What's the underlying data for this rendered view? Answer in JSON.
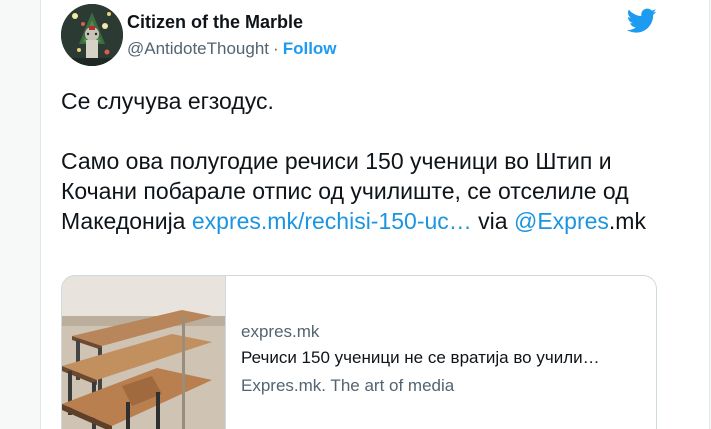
{
  "user": {
    "display_name": "Citizen of the Marble",
    "handle": "@AntidoteThought",
    "separator": "·",
    "follow_label": "Follow",
    "avatar_icon": "avatar-photo"
  },
  "brand": {
    "icon": "twitter-bird-icon",
    "color": "#1d9bf0"
  },
  "tweet": {
    "line1": "Се случува егзодус.",
    "body": "Само ова полугодие речиси 150 ученици во Штип и Кочани побарале отпис од училиште, се отселиле од Македонија ",
    "link_text": "expres.mk/rechisi-150-uc…",
    "via_text": " via ",
    "mention": "@Expres",
    "mention_suffix": ".mk"
  },
  "link_preview": {
    "domain": "expres.mk",
    "title": "Речиси 150 ученици не се вратија во учили…",
    "description": "Expres.mk. The art of media",
    "image": "classroom-chairs-on-desks"
  },
  "colors": {
    "link": "#1b95e0",
    "text": "#0f1419",
    "secondary": "#536471",
    "border": "#cfd9de"
  }
}
